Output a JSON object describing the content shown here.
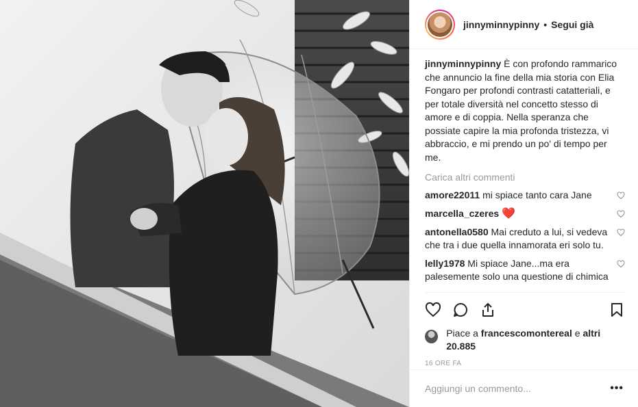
{
  "header": {
    "username": "jinnyminnypinny",
    "separator": "•",
    "follow_label": "Segui già"
  },
  "caption": {
    "username": "jinnyminnypinny",
    "text": "È con profondo rammarico che annuncio la fine della mia storia con Elia Fongaro per profondi contrasti catatteriali, e per totale diversità nel concetto stesso di amore e di coppia. Nella speranza che possiate capire la mia profonda tristezza, vi abbraccio, e mi prendo un po' di tempo per me."
  },
  "load_more_label": "Carica altri commenti",
  "comments": [
    {
      "username": "amore22011",
      "text": "mi spiace tanto cara Jane"
    },
    {
      "username": "marcella_czeres",
      "text": "❤️"
    },
    {
      "username": "antonella0580",
      "text": "Mai creduto a lui, si vedeva che tra i due quella innamorata eri solo tu."
    },
    {
      "username": "lelly1978",
      "text": "Mi spiace Jane...ma era palesemente solo una questione di chimica"
    }
  ],
  "likes": {
    "prefix": "Piace a",
    "user": "francescomontereal",
    "connector": "e",
    "others": "altri 20.885"
  },
  "timestamp": "16 ORE FA",
  "add_comment": {
    "placeholder": "Aggiungi un commento...",
    "more_label": "•••"
  },
  "icons": {
    "like": "heart-icon",
    "comment": "comment-icon",
    "share": "share-icon",
    "save": "bookmark-icon",
    "comment_like": "heart-icon"
  },
  "colors": {
    "text": "#262626",
    "muted": "#999999",
    "border": "#efefef",
    "heart_emoji": "#e0245e"
  }
}
